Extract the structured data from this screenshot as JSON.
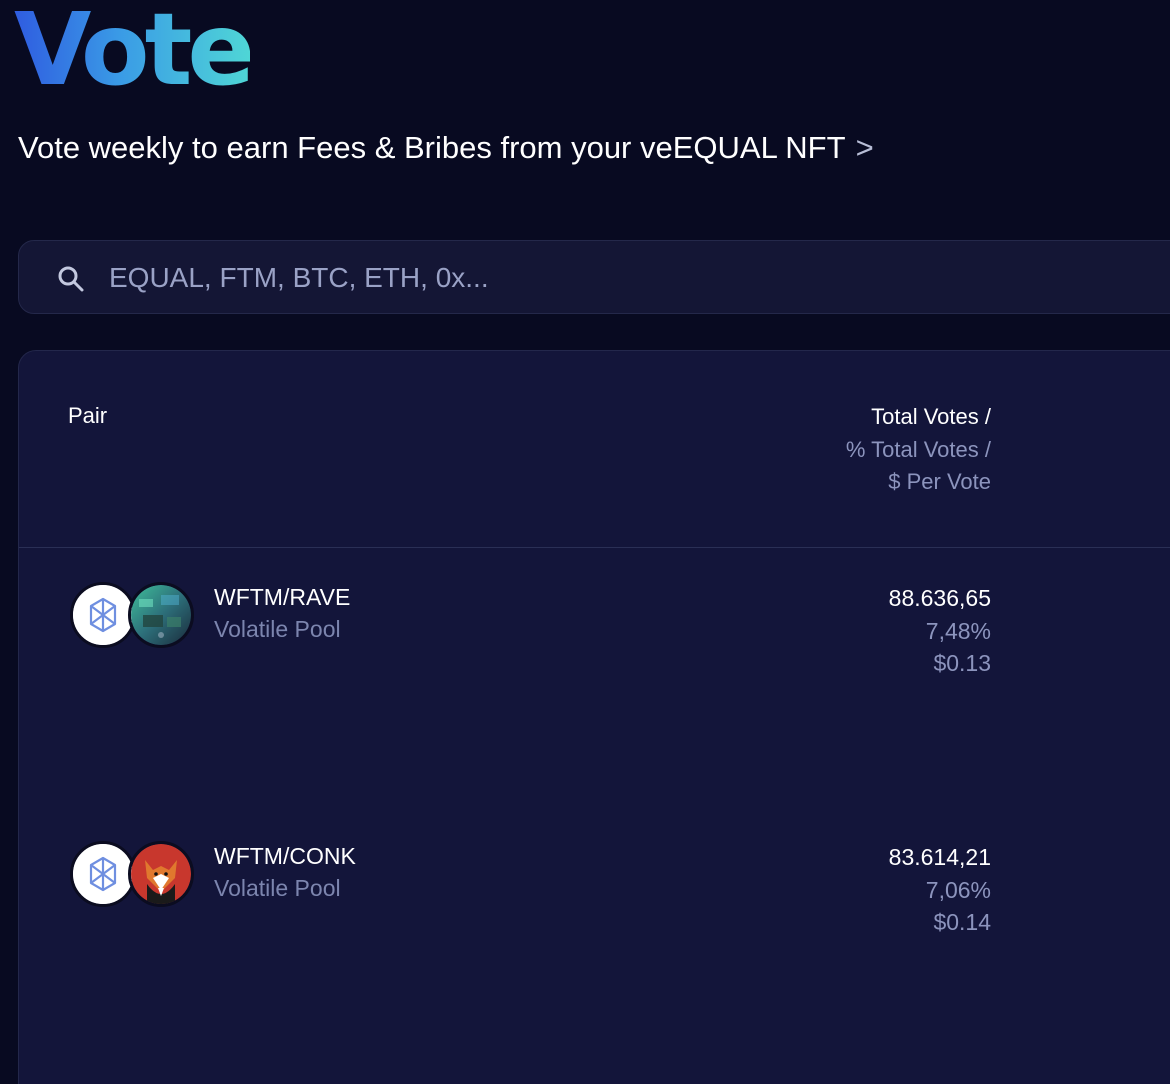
{
  "page": {
    "title": "Vote",
    "subtitle": "Vote weekly to earn Fees & Bribes from your veEQUAL NFT",
    "subtitle_chevron": ">"
  },
  "search": {
    "icon": "search-icon",
    "placeholder": "EQUAL, FTM, BTC, ETH, 0x...",
    "value": ""
  },
  "table": {
    "headers": {
      "pair": "Pair",
      "votes_line1": "Total Votes /",
      "votes_line2": "% Total Votes /",
      "votes_line3": "$ Per Vote"
    },
    "rows": [
      {
        "pair": "WFTM/RAVE",
        "type": "Volatile Pool",
        "total_votes": "88.636,65",
        "percent_votes": "7,48%",
        "per_vote": "$0.13",
        "token_icons": [
          "fantom-icon",
          "rave-icon"
        ]
      },
      {
        "pair": "WFTM/CONK",
        "type": "Volatile Pool",
        "total_votes": "83.614,21",
        "percent_votes": "7,06%",
        "per_vote": "$0.14",
        "token_icons": [
          "fantom-icon",
          "conk-icon"
        ]
      }
    ]
  },
  "colors": {
    "background": "#080a21",
    "panel": "#13153a",
    "title_gradient_start": "#2f5ce0",
    "title_gradient_end": "#4fd6d6",
    "muted_text": "#8c94bd"
  }
}
